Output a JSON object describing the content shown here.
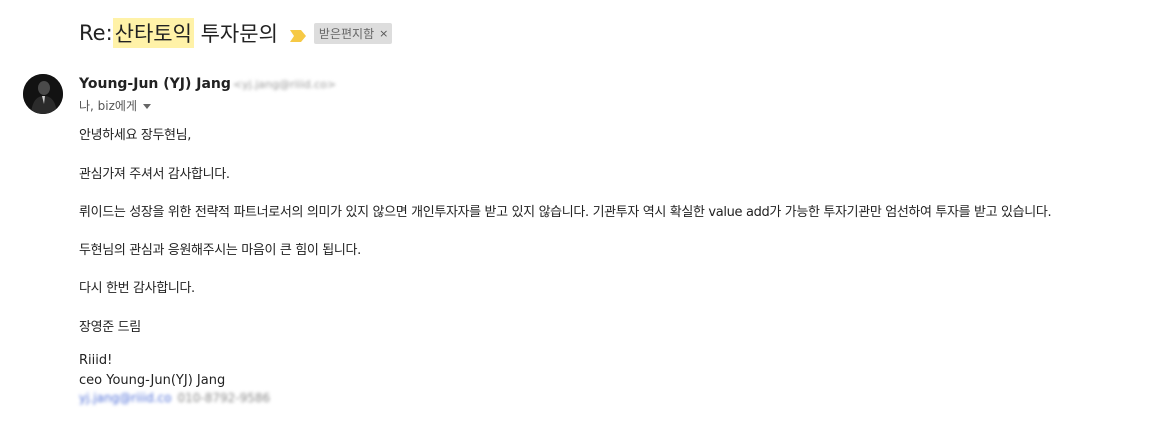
{
  "email": {
    "subject_prefix": "Re: ",
    "subject_highlight": "산타토익",
    "subject_rest": " 투자문의",
    "label": "받은편지함",
    "label_close": "×",
    "importance_color": "#f6c945",
    "sender_name": "Young-Jun (YJ) Jang",
    "sender_email": "<yj.jang@riiid.co>",
    "recipients": "나, biz에게",
    "body": [
      "안녕하세요 장두현님,",
      "관심가져 주셔서 감사합니다.",
      "뤼이드는 성장을 위한 전략적 파트너로서의 의미가 있지 않으면 개인투자자를 받고 있지 않습니다. 기관투자 역시 확실한 value add가 가능한 투자기관만 엄선하여 투자를 받고 있습니다.",
      "두현님의 관심과 응원해주시는 마음이 큰 힘이 됩니다.",
      "다시 한번 감사합니다.",
      "장영준 드림"
    ],
    "signature": {
      "company": "Riiid!",
      "title": "ceo Young-Jun(YJ) Jang",
      "email": "yj.jang@riiid.co",
      "phone": "010-8792-9586"
    }
  }
}
